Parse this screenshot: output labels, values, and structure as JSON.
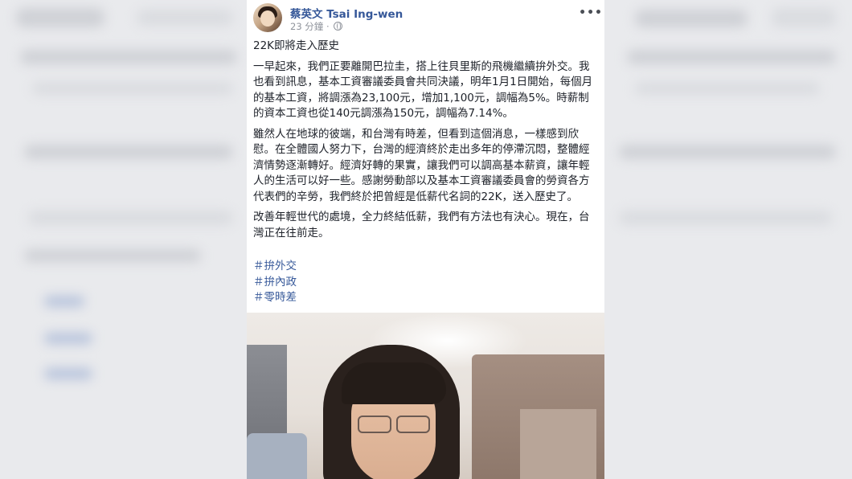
{
  "post": {
    "author": "蔡英文 Tsai Ing-wen",
    "timestamp": "23 分鐘",
    "separator": "·",
    "more_label": "•••",
    "title": "22K即將走入歷史",
    "paragraphs": [
      "一早起來，我們正要離開巴拉圭，搭上往貝里斯的飛機繼續拚外交。我也看到訊息，基本工資審議委員會共同決議，明年1月1日開始，每個月的基本工資，將調漲為23,100元，增加1,100元，調幅為5%。時薪制的資本工資也從140元調漲為150元，調幅為7.14%。",
      "雖然人在地球的彼端，和台灣有時差，但看到這個消息，一樣感到欣慰。在全體國人努力下，台灣的經濟終於走出多年的停滯沉悶，整體經濟情勢逐漸轉好。經濟好轉的果實，讓我們可以調高基本薪資，讓年輕人的生活可以好一些。感謝勞動部以及基本工資審議委員會的勞資各方代表們的辛勞，我們終於把曾經是低薪代名詞的22K，送入歷史了。",
      "改善年輕世代的處境，全力終結低薪，我們有方法也有決心。現在，台灣正在往前走。"
    ],
    "hashtags": [
      "＃拚外交",
      "＃拚內政",
      "＃零時差"
    ]
  }
}
